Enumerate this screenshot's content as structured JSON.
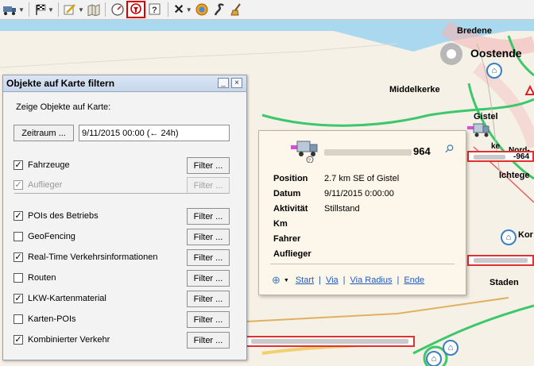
{
  "toolbar": {
    "items": [
      {
        "icon": "truck-icon"
      },
      {
        "icon": "checkered-flag-icon"
      },
      {
        "icon": "edit-icon"
      },
      {
        "icon": "map-book-icon"
      },
      {
        "icon": "speedometer-icon"
      },
      {
        "icon": "map-filter-icon"
      },
      {
        "icon": "help-icon"
      },
      {
        "icon": "close-x-icon"
      },
      {
        "icon": "globe-icon"
      },
      {
        "icon": "route-icon"
      },
      {
        "icon": "broom-icon"
      }
    ]
  },
  "map": {
    "places": {
      "bredene": "Bredene",
      "oostende": "Oostende",
      "middelkerke": "Middelkerke",
      "gistel": "Gistel",
      "ichtegem": "Ichtege",
      "koekelare": "Kor",
      "stade": "Staden",
      "vehicle_ref": "-964",
      "ke": "ke",
      "noord": "Nord-B"
    }
  },
  "filter_panel": {
    "title": "Objekte auf Karte filtern",
    "minimize": "_",
    "close": "×",
    "show_label": "Zeige Objekte auf Karte:",
    "period_button": "Zeitraum ...",
    "period_value": "9/11/2015 00:00 (← 24h)",
    "filter_label": "Filter ...",
    "items": [
      {
        "label": "Fahrzeuge",
        "checked": true,
        "enabled": true
      },
      {
        "label": "Auflieger",
        "checked": true,
        "enabled": false
      },
      {
        "label": "POIs des Betriebs",
        "checked": true,
        "enabled": true
      },
      {
        "label": "GeoFencing",
        "checked": false,
        "enabled": true
      },
      {
        "label": "Real-Time Verkehrsinformationen",
        "checked": true,
        "enabled": true
      },
      {
        "label": "Routen",
        "checked": false,
        "enabled": true
      },
      {
        "label": "LKW-Kartenmaterial",
        "checked": true,
        "enabled": true
      },
      {
        "label": "Karten-POIs",
        "checked": false,
        "enabled": true
      },
      {
        "label": "Kombinierter Verkehr",
        "checked": true,
        "enabled": true
      }
    ]
  },
  "popup": {
    "vehicle_suffix": "964",
    "fields": [
      {
        "key": "Position",
        "value": "2.7 km SE of Gistel"
      },
      {
        "key": "Datum",
        "value": "9/11/2015 0:00:00"
      },
      {
        "key": "Aktivität",
        "value": "Stillstand"
      },
      {
        "key": "Km",
        "value": ""
      },
      {
        "key": "Fahrer",
        "value": ""
      },
      {
        "key": "Auflieger",
        "value": ""
      }
    ],
    "links": {
      "start": "Start",
      "via": "Via",
      "via_radius": "Via Radius",
      "end": "Ende"
    },
    "separator": "|"
  },
  "colors": {
    "sea": "#aad8ee",
    "land": "#f6f1e6",
    "road_main": "#3cc76a",
    "highlight_red": "#d40000"
  }
}
